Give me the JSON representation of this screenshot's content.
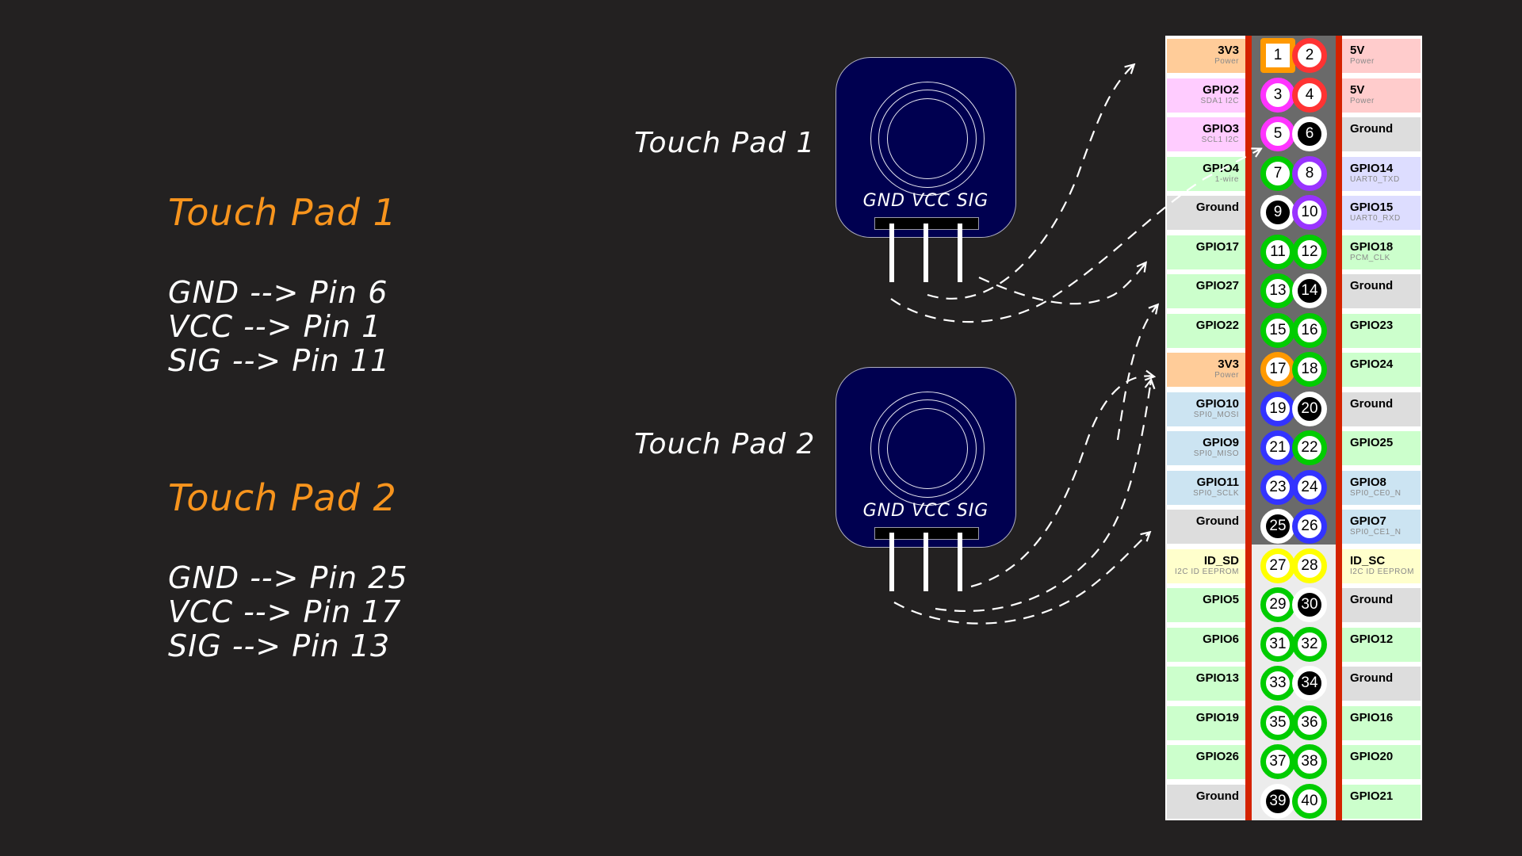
{
  "notes": [
    {
      "title": "Touch Pad 1",
      "lines": [
        "GND --> Pin 6",
        "VCC --> Pin 1",
        "SIG --> Pin 11"
      ]
    },
    {
      "title": "Touch Pad 2",
      "lines": [
        "GND --> Pin 25",
        "VCC --> Pin 17",
        "SIG --> Pin 13"
      ]
    }
  ],
  "pads": [
    {
      "label": "Touch Pad 1",
      "pins_text": "GND VCC SIG",
      "connections": {
        "GND": 6,
        "VCC": 1,
        "SIG": 11
      }
    },
    {
      "label": "Touch Pad 2",
      "pins_text": "GND VCC SIG",
      "connections": {
        "GND": 25,
        "VCC": 17,
        "SIG": 13
      }
    }
  ],
  "colors": {
    "background": "#232121",
    "title_orange": "#f7941d",
    "pad_blue": "#000050",
    "rail_red": "#d42200",
    "power_3v3": "#ffcc99",
    "power_5v": "#ffcccc",
    "i2c": "#ffccff",
    "gpio": "#ccffcc",
    "ground": "#dddddd",
    "uart": "#ddddff",
    "spi": "#cce4f2",
    "eeprom": "#ffffcc"
  },
  "pinout": {
    "rows": [
      {
        "left": {
          "pin": 1,
          "name": "3V3",
          "sub": "Power",
          "type": "power_3v3"
        },
        "right": {
          "pin": 2,
          "name": "5V",
          "sub": "Power",
          "type": "power_5v"
        }
      },
      {
        "left": {
          "pin": 3,
          "name": "GPIO2",
          "sub": "SDA1 I2C",
          "type": "i2c"
        },
        "right": {
          "pin": 4,
          "name": "5V",
          "sub": "Power",
          "type": "power_5v"
        }
      },
      {
        "left": {
          "pin": 5,
          "name": "GPIO3",
          "sub": "SCL1 I2C",
          "type": "i2c"
        },
        "right": {
          "pin": 6,
          "name": "Ground",
          "sub": "",
          "type": "ground"
        }
      },
      {
        "left": {
          "pin": 7,
          "name": "GPIO4",
          "sub": "1-wire",
          "type": "gpio"
        },
        "right": {
          "pin": 8,
          "name": "GPIO14",
          "sub": "UART0_TXD",
          "type": "uart"
        }
      },
      {
        "left": {
          "pin": 9,
          "name": "Ground",
          "sub": "",
          "type": "ground"
        },
        "right": {
          "pin": 10,
          "name": "GPIO15",
          "sub": "UART0_RXD",
          "type": "uart"
        }
      },
      {
        "left": {
          "pin": 11,
          "name": "GPIO17",
          "sub": "",
          "type": "gpio"
        },
        "right": {
          "pin": 12,
          "name": "GPIO18",
          "sub": "PCM_CLK",
          "type": "gpio"
        }
      },
      {
        "left": {
          "pin": 13,
          "name": "GPIO27",
          "sub": "",
          "type": "gpio"
        },
        "right": {
          "pin": 14,
          "name": "Ground",
          "sub": "",
          "type": "ground"
        }
      },
      {
        "left": {
          "pin": 15,
          "name": "GPIO22",
          "sub": "",
          "type": "gpio"
        },
        "right": {
          "pin": 16,
          "name": "GPIO23",
          "sub": "",
          "type": "gpio"
        }
      },
      {
        "left": {
          "pin": 17,
          "name": "3V3",
          "sub": "Power",
          "type": "power_3v3"
        },
        "right": {
          "pin": 18,
          "name": "GPIO24",
          "sub": "",
          "type": "gpio"
        }
      },
      {
        "left": {
          "pin": 19,
          "name": "GPIO10",
          "sub": "SPI0_MOSI",
          "type": "spi"
        },
        "right": {
          "pin": 20,
          "name": "Ground",
          "sub": "",
          "type": "ground"
        }
      },
      {
        "left": {
          "pin": 21,
          "name": "GPIO9",
          "sub": "SPI0_MISO",
          "type": "spi"
        },
        "right": {
          "pin": 22,
          "name": "GPIO25",
          "sub": "",
          "type": "gpio"
        }
      },
      {
        "left": {
          "pin": 23,
          "name": "GPIO11",
          "sub": "SPI0_SCLK",
          "type": "spi"
        },
        "right": {
          "pin": 24,
          "name": "GPIO8",
          "sub": "SPI0_CE0_N",
          "type": "spi"
        }
      },
      {
        "left": {
          "pin": 25,
          "name": "Ground",
          "sub": "",
          "type": "ground"
        },
        "right": {
          "pin": 26,
          "name": "GPIO7",
          "sub": "SPI0_CE1_N",
          "type": "spi"
        }
      },
      {
        "left": {
          "pin": 27,
          "name": "ID_SD",
          "sub": "I2C ID EEPROM",
          "type": "eeprom"
        },
        "right": {
          "pin": 28,
          "name": "ID_SC",
          "sub": "I2C ID EEPROM",
          "type": "eeprom"
        }
      },
      {
        "left": {
          "pin": 29,
          "name": "GPIO5",
          "sub": "",
          "type": "gpio"
        },
        "right": {
          "pin": 30,
          "name": "Ground",
          "sub": "",
          "type": "ground"
        }
      },
      {
        "left": {
          "pin": 31,
          "name": "GPIO6",
          "sub": "",
          "type": "gpio"
        },
        "right": {
          "pin": 32,
          "name": "GPIO12",
          "sub": "",
          "type": "gpio"
        }
      },
      {
        "left": {
          "pin": 33,
          "name": "GPIO13",
          "sub": "",
          "type": "gpio"
        },
        "right": {
          "pin": 34,
          "name": "Ground",
          "sub": "",
          "type": "ground"
        }
      },
      {
        "left": {
          "pin": 35,
          "name": "GPIO19",
          "sub": "",
          "type": "gpio"
        },
        "right": {
          "pin": 36,
          "name": "GPIO16",
          "sub": "",
          "type": "gpio"
        }
      },
      {
        "left": {
          "pin": 37,
          "name": "GPIO26",
          "sub": "",
          "type": "gpio"
        },
        "right": {
          "pin": 38,
          "name": "GPIO20",
          "sub": "",
          "type": "gpio"
        }
      },
      {
        "left": {
          "pin": 39,
          "name": "Ground",
          "sub": "",
          "type": "ground"
        },
        "right": {
          "pin": 40,
          "name": "GPIO21",
          "sub": "",
          "type": "gpio"
        }
      }
    ],
    "pin_ring_colors": {
      "power_3v3": "#ff9900",
      "power_5v": "#ff3333",
      "i2c": "#ff33ff",
      "gpio": "#00cc00",
      "ground": "#ffffff",
      "uart": "#9933ff",
      "spi": "#3333ff",
      "eeprom": "#ffff00"
    }
  }
}
